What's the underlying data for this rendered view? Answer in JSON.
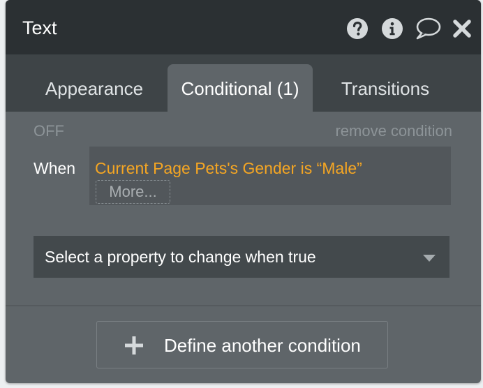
{
  "window": {
    "title": "Text",
    "icons": [
      "help-icon",
      "info-icon",
      "comment-icon",
      "close-icon"
    ]
  },
  "tabs": [
    {
      "label": "Appearance",
      "active": false
    },
    {
      "label": "Conditional (1)",
      "active": true
    },
    {
      "label": "Transitions",
      "active": false
    }
  ],
  "condition": {
    "status": "OFF",
    "remove_label": "remove condition",
    "when_label": "When",
    "expression": "Current Page Pets's Gender is “Male”",
    "more_label": "More..."
  },
  "property_select": {
    "placeholder": "Select a property to change when true"
  },
  "define_button": {
    "label": "Define another condition"
  },
  "colors": {
    "panel": "#5f6569",
    "titlebar": "#2b3033",
    "tabbar": "#3e4447",
    "expression": "#f5a623"
  }
}
